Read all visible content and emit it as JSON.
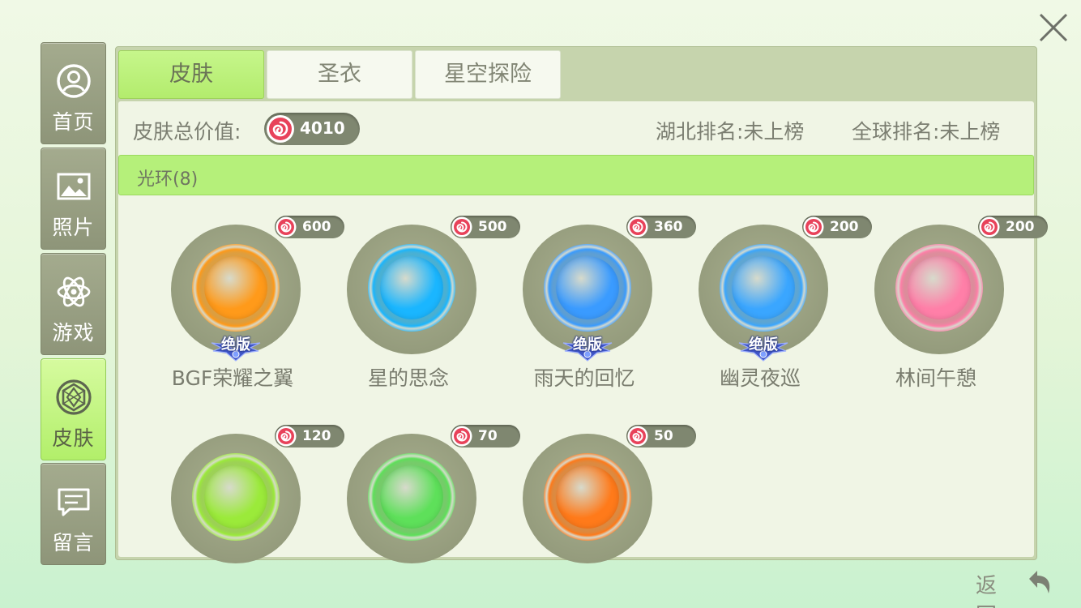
{
  "close": {
    "icon": "close-icon"
  },
  "sidebar": {
    "items": [
      {
        "label": "首页",
        "icon": "profile-icon"
      },
      {
        "label": "照片",
        "icon": "photo-icon"
      },
      {
        "label": "游戏",
        "icon": "atom-icon"
      },
      {
        "label": "皮肤",
        "icon": "gem-icon",
        "active": true
      },
      {
        "label": "留言",
        "icon": "message-icon"
      }
    ]
  },
  "tabs": [
    {
      "label": "皮肤",
      "active": true
    },
    {
      "label": "圣衣"
    },
    {
      "label": "星空探险"
    }
  ],
  "summary": {
    "label": "皮肤总价值:",
    "value": "4010",
    "region_rank": "湖北排名:未上榜",
    "global_rank": "全球排名:未上榜"
  },
  "category": {
    "label": "光环(8)"
  },
  "badge_text": "绝版",
  "skins": [
    {
      "name": "BGF荣耀之翼",
      "price": "600",
      "limited": true,
      "color": "#ff9a1a"
    },
    {
      "name": "星的思念",
      "price": "500",
      "limited": false,
      "color": "#1ab6ff"
    },
    {
      "name": "雨天的回忆",
      "price": "360",
      "limited": true,
      "color": "#3a9bff"
    },
    {
      "name": "幽灵夜巡",
      "price": "200",
      "limited": true,
      "color": "#3aa6ff"
    },
    {
      "name": "林间午憩",
      "price": "200",
      "limited": false,
      "color": "#ff7fa8"
    },
    {
      "name": "",
      "price": "120",
      "limited": false,
      "color": "#9bea3a"
    },
    {
      "name": "",
      "price": "70",
      "limited": false,
      "color": "#5ee05a"
    },
    {
      "name": "",
      "price": "50",
      "limited": false,
      "color": "#ff7a1a"
    }
  ],
  "back": {
    "label": "返回",
    "icon": "back-arrow-icon"
  }
}
